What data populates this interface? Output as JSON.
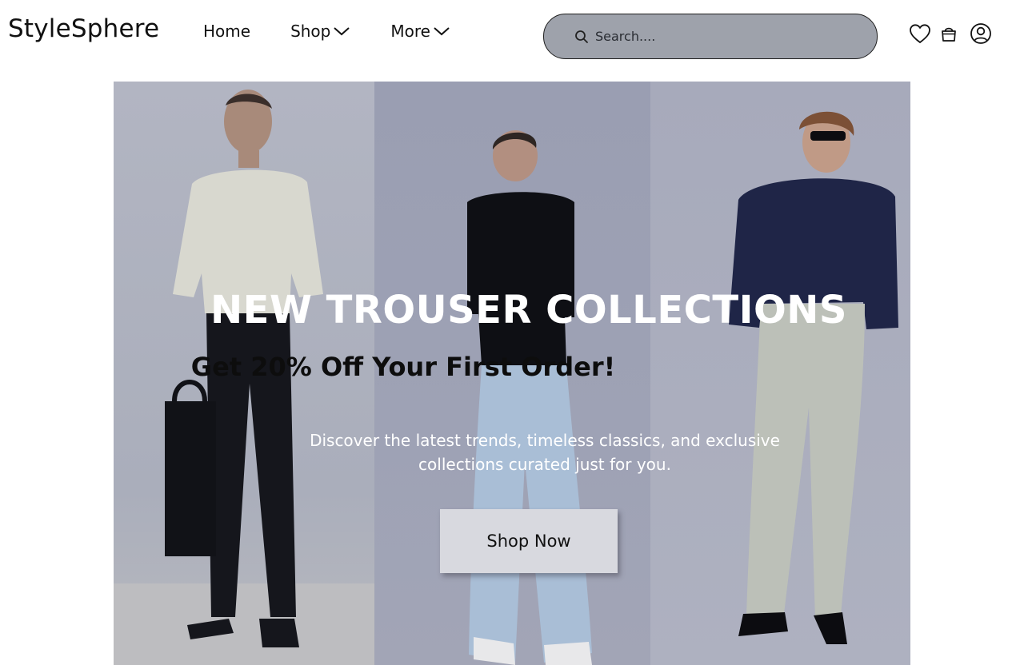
{
  "header": {
    "logo": "StyleSphere",
    "nav": {
      "home": "Home",
      "shop": "Shop",
      "more": "More"
    },
    "search": {
      "placeholder": "Search...."
    },
    "icons": [
      "heart-icon",
      "shopping-bag-icon",
      "user-icon",
      "search-icon",
      "chevron-down-icon"
    ]
  },
  "hero": {
    "title": "NEW TROUSER COLLECTIONS",
    "subtitle": "Get 20% Off Your First Order!",
    "description": "Discover the latest trends, timeless classics, and exclusive collections curated just for you.",
    "cta_label": "Shop Now"
  },
  "colors": {
    "search_bg": "#9ea2ab",
    "hero_overlay": "#a9adbb",
    "cta_bg": "#d8d9df",
    "title_text": "#ffffff",
    "subtitle_text": "#0d0d0d"
  }
}
